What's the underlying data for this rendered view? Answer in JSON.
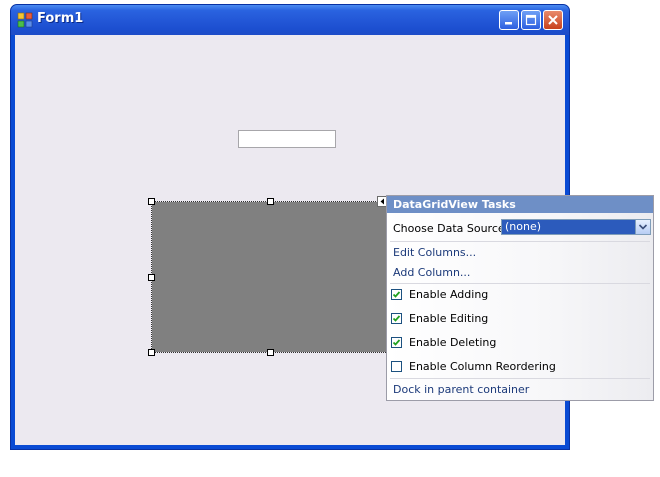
{
  "window": {
    "title": "Form1",
    "controls": [
      "minimize",
      "maximize",
      "close"
    ]
  },
  "tasks_panel": {
    "title": "DataGridView Tasks",
    "data_source_label": "Choose Data Source",
    "data_source_value": "(none)",
    "edit_columns": "Edit Columns...",
    "add_column": "Add Column...",
    "checkboxes": [
      {
        "label": "Enable Adding",
        "checked": true
      },
      {
        "label": "Enable Editing",
        "checked": true
      },
      {
        "label": "Enable Deleting",
        "checked": true
      },
      {
        "label": "Enable Column Reordering",
        "checked": false
      }
    ],
    "dock": "Dock in parent container"
  },
  "colors": {
    "title_bar": "#2256d6",
    "grid_fill": "#808080",
    "panel_header": "#6e8fc6",
    "check_mark": "#21a121"
  }
}
